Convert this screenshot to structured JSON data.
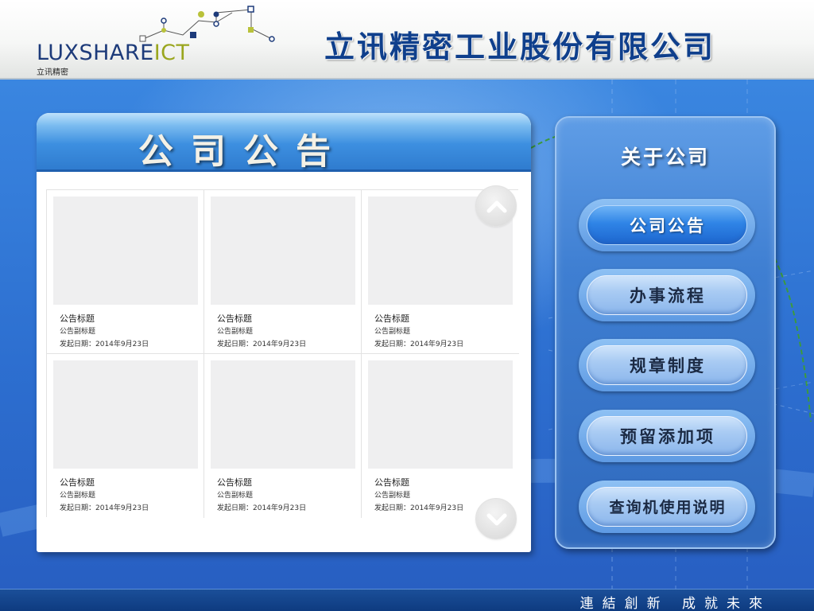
{
  "header": {
    "logo_word_main": "LUXSHARE",
    "logo_word_accent": "ICT",
    "logo_sub": "立讯精密",
    "company_name": "立讯精密工业股份有限公司"
  },
  "panel": {
    "title": "公司公告",
    "cards": [
      {
        "title": "公告标题",
        "subtitle": "公告副标题",
        "date": "发起日期：2014年9月23日"
      },
      {
        "title": "公告标题",
        "subtitle": "公告副标题",
        "date": "发起日期：2014年9月23日"
      },
      {
        "title": "公告标题",
        "subtitle": "公告副标题",
        "date": "发起日期：2014年9月23日"
      },
      {
        "title": "公告标题",
        "subtitle": "公告副标题",
        "date": "发起日期：2014年9月23日"
      },
      {
        "title": "公告标题",
        "subtitle": "公告副标题",
        "date": "发起日期：2014年9月23日"
      },
      {
        "title": "公告标题",
        "subtitle": "公告副标题",
        "date": "发起日期：2014年9月23日"
      }
    ],
    "scroll_up_icon": "chevron-up-icon",
    "scroll_down_icon": "chevron-down-icon"
  },
  "sidebar": {
    "title": "关于公司",
    "items": [
      {
        "label": "公司公告",
        "active": true
      },
      {
        "label": "办事流程",
        "active": false
      },
      {
        "label": "规章制度",
        "active": false
      },
      {
        "label": "预留添加项",
        "active": false
      },
      {
        "label": "查询机使用说明",
        "active": false
      }
    ]
  },
  "footer": {
    "slogan": "連結創新 成就未來"
  },
  "colors": {
    "title_blue": "#0f3f8c",
    "logo_blue": "#1d3b7a",
    "logo_green": "#9aa61e",
    "background_blue": "#2e6fd0",
    "footer_blue": "#0e3b80"
  }
}
